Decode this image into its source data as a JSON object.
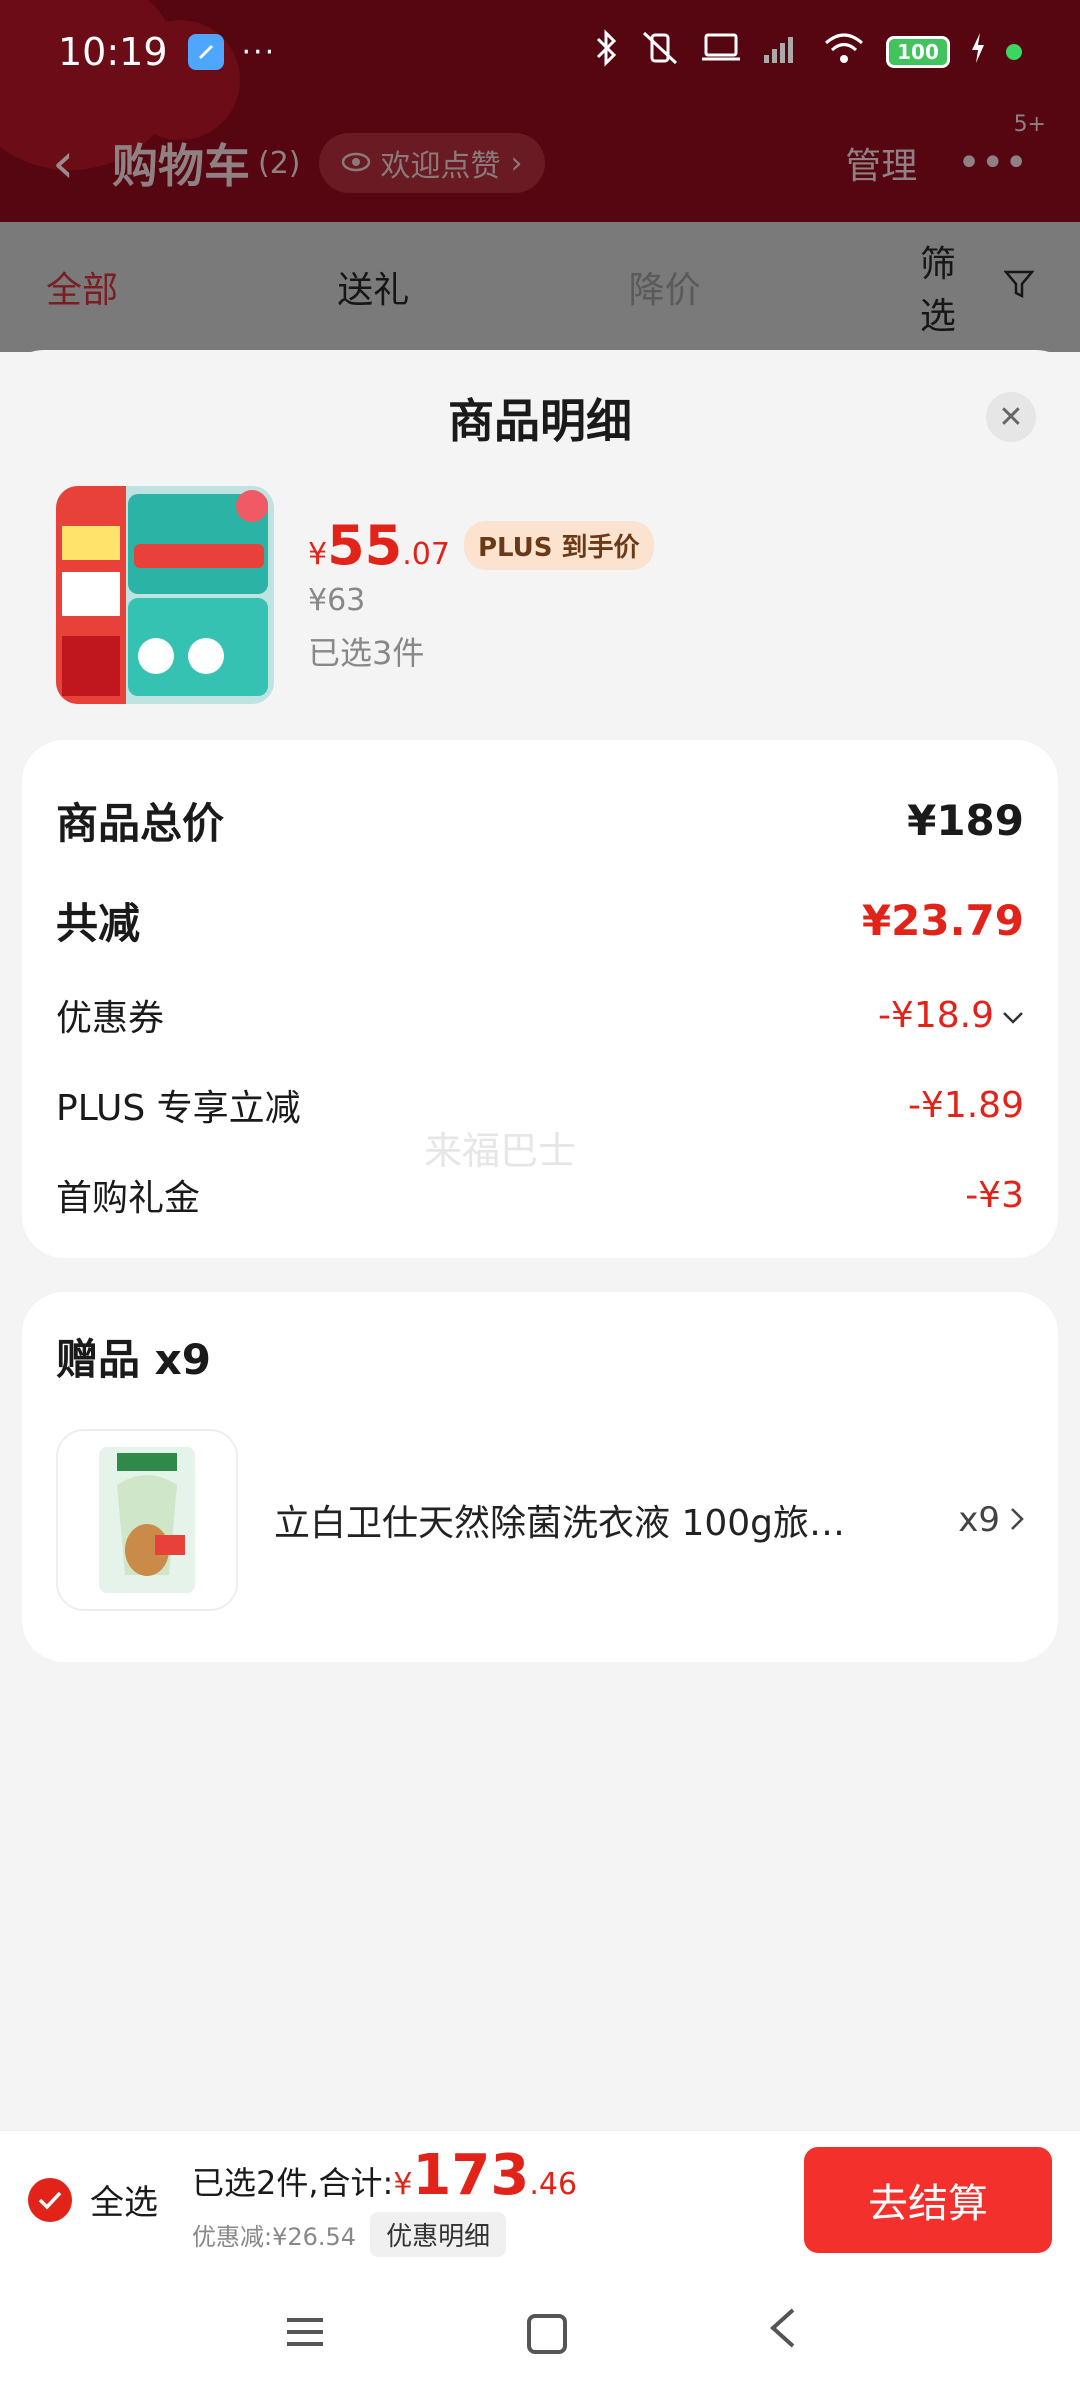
{
  "status_bar": {
    "time": "10:19",
    "more": "···",
    "battery": "100"
  },
  "nav": {
    "back": "‹",
    "title": "购物车",
    "count": "(2)",
    "pill": "欢迎点赞",
    "pill_arrow": "›",
    "manage": "管理",
    "more": "•••",
    "badge": "5+"
  },
  "tabs": [
    {
      "label": "全部"
    },
    {
      "label": "送礼"
    },
    {
      "label": "降价"
    }
  ],
  "filter": {
    "label": "筛选"
  },
  "sheet": {
    "title": "商品明细",
    "close": "✕",
    "product": {
      "price_symbol": "¥",
      "price_int": "55",
      "price_dec": ".07",
      "tag": "PLUS 到手价",
      "original_price": "¥63",
      "selected": "已选3件"
    },
    "price_rows": [
      {
        "label": "商品总价",
        "value": "¥189"
      },
      {
        "label": "共减",
        "value": "¥23.79"
      },
      {
        "label": "优惠券",
        "value": "-¥18.9"
      },
      {
        "label": "PLUS 专享立减",
        "value": "-¥1.89"
      },
      {
        "label": "首购礼金",
        "value": "-¥3"
      }
    ],
    "watermark": "来福巴士",
    "gift": {
      "title": "赠品 x9",
      "name": "立白卫仕天然除菌洗衣液 100g旅…",
      "qty": "x9"
    }
  },
  "checkout": {
    "select_all": "全选",
    "summary_prefix": "已选2件,合计:",
    "total_symbol": "¥",
    "total_int": "173",
    "total_dec": ".46",
    "discount": "优惠减:¥26.54",
    "detail_button": "优惠明细",
    "checkout_button": "去结算"
  },
  "colors": {
    "accent": "#e2231a",
    "checkout_button": "#f3302c",
    "plus_tag_bg": "#fbe3cf"
  }
}
